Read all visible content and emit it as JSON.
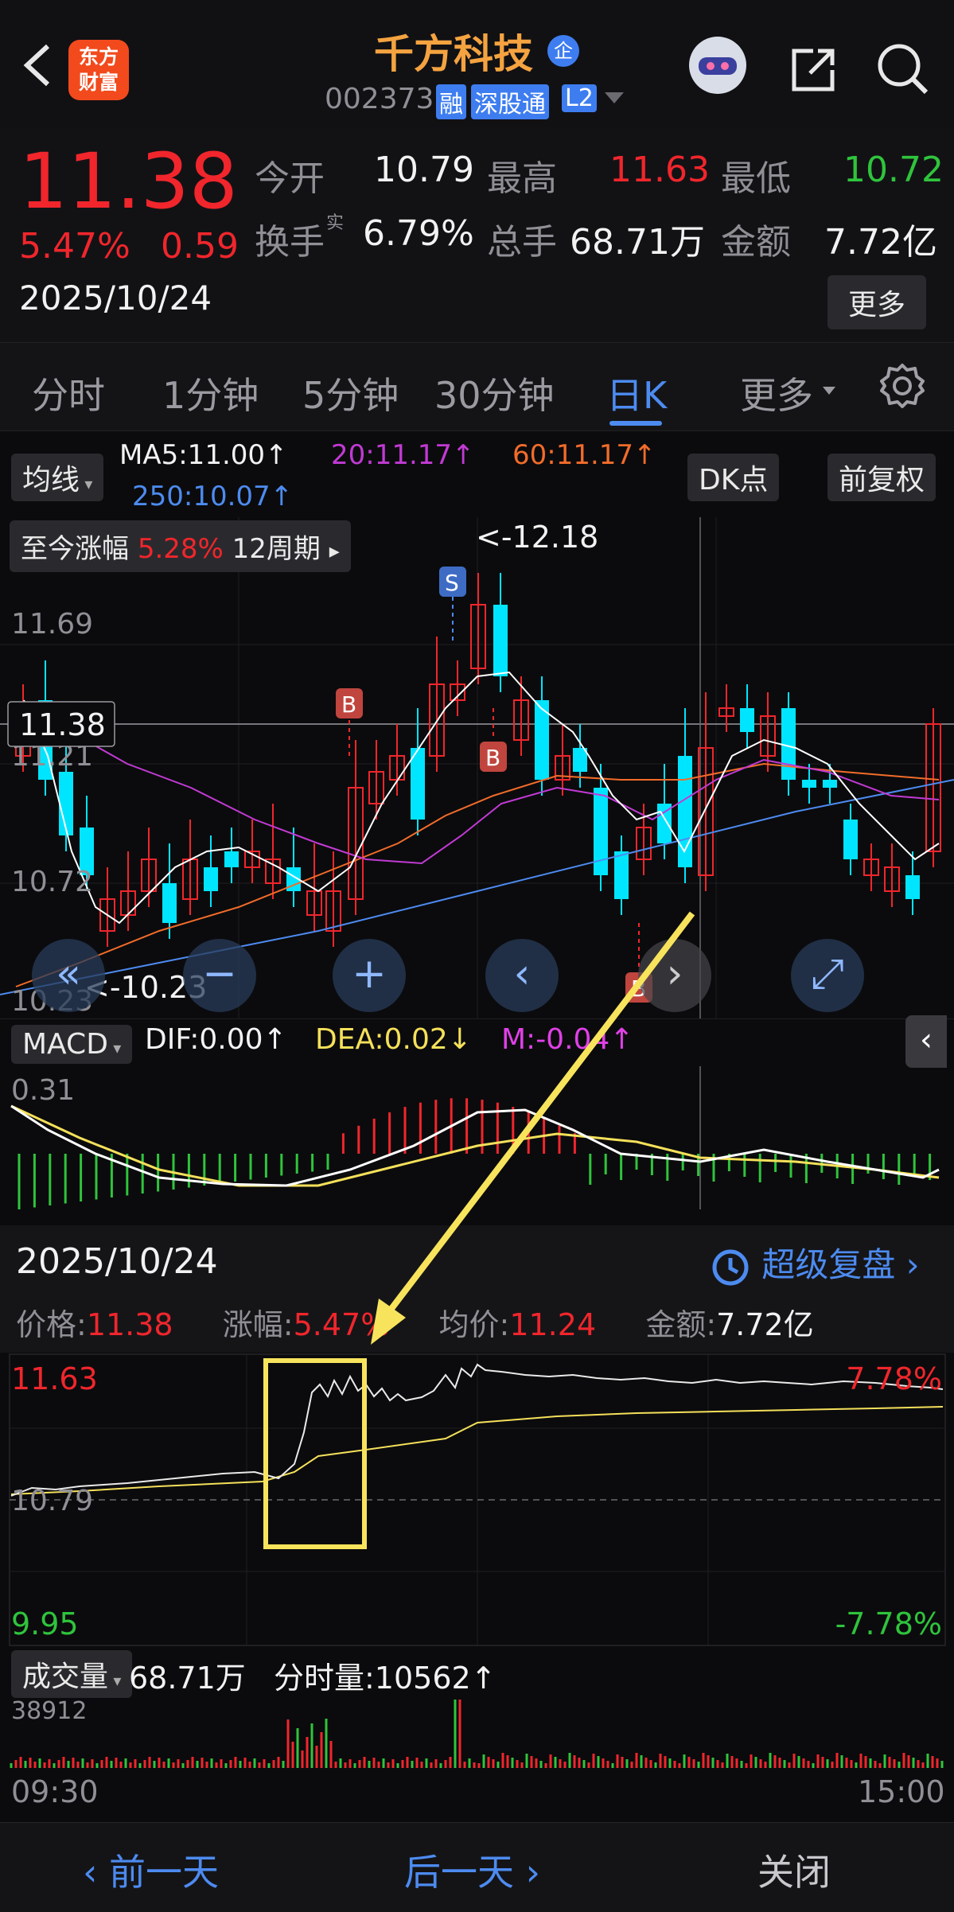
{
  "header": {
    "logo_line1": "东方",
    "logo_line2": "财富",
    "stock_name": "千方科技",
    "enterprise_badge": "企",
    "stock_code": "002373",
    "tags": [
      "融",
      "深股通",
      "L2"
    ]
  },
  "quote": {
    "price": "11.38",
    "change_pct": "5.47%",
    "change_abs": "0.59",
    "date": "2025/10/24",
    "open_label": "今开",
    "open_value": "10.79",
    "high_label": "最高",
    "high_value": "11.63",
    "low_label": "最低",
    "low_value": "10.72",
    "turnover_label": "换手",
    "turnover_sup": "实",
    "turnover_value": "6.79%",
    "volume_label": "总手",
    "volume_value": "68.71万",
    "amount_label": "金额",
    "amount_value": "7.72亿",
    "more_button": "更多"
  },
  "tabs": [
    "分时",
    "1分钟",
    "5分钟",
    "30分钟",
    "日K",
    "更多"
  ],
  "active_tab": "日K",
  "kline": {
    "ma_button": "均线",
    "ma5": "MA5:11.00↑",
    "ma20": "20:11.17↑",
    "ma60": "60:11.17↑",
    "ma250": "250:10.07↑",
    "dk_button": "DK点",
    "adjust_button": "前复权",
    "range_label": "至今涨幅",
    "range_value": "5.28%",
    "range_period": "12周期",
    "max_label": "<-12.18",
    "min_label": "<-10.23",
    "axis_top": "11.69",
    "axis_mid": "11.21",
    "axis_low": "10.72",
    "axis_bottom": "10.23",
    "cursor_price": "11.38",
    "marker_s": "S",
    "marker_b": "B"
  },
  "macd": {
    "label": "MACD",
    "dif": "DIF:0.00↑",
    "dea": "DEA:0.02↓",
    "m": "M:-0.04↑",
    "axis_top": "0.31"
  },
  "intraday": {
    "date": "2025/10/24",
    "replay_label": "超级复盘",
    "price_label": "价格:",
    "price_value": "11.38",
    "pct_label": "涨幅:",
    "pct_value": "5.47%",
    "avg_label": "均价:",
    "avg_value": "11.24",
    "amount_label": "金额:",
    "amount_value": "7.72亿",
    "axis_high": "11.63",
    "axis_base": "10.79",
    "axis_low": "9.95",
    "pct_high": "7.78%",
    "pct_low": "-7.78%",
    "volume_button": "成交量",
    "total_volume": "68.71万",
    "tick_volume": "分时量:10562↑",
    "volume_axis_max": "38912",
    "time_start": "09:30",
    "time_end": "15:00"
  },
  "footer": {
    "prev_day": "前一天",
    "next_day": "后一天",
    "close": "关闭"
  },
  "colors": {
    "up": "#f0262c",
    "down": "#00e5ff",
    "ma5": "#ffffff",
    "ma20": "#c23ad4",
    "ma60": "#f26c2a",
    "ma250": "#4d8bf0",
    "dea": "#f5e05a",
    "accent": "#4d8bf0",
    "annotation": "#f8e45c"
  }
}
